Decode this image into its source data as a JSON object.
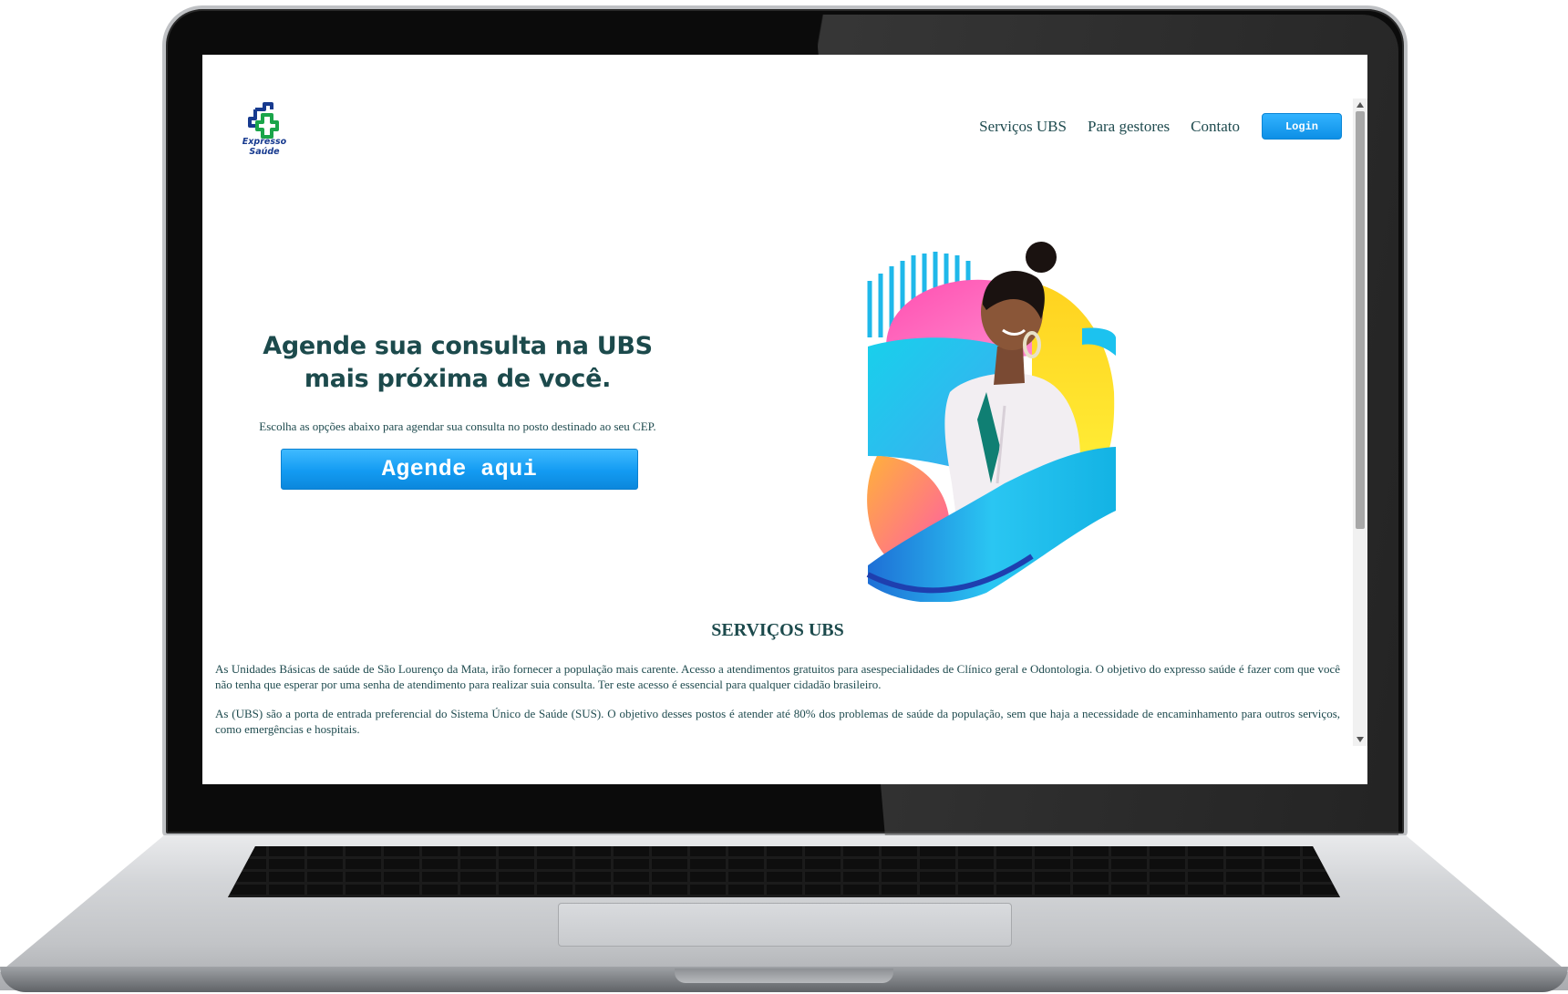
{
  "header": {
    "logo_text": "Expresso Saúde",
    "nav": [
      {
        "label": "Serviços UBS"
      },
      {
        "label": "Para gestores"
      },
      {
        "label": "Contato"
      }
    ],
    "login_label": "Login"
  },
  "hero": {
    "title": "Agende sua consulta na UBS mais próxima de você.",
    "subtitle": "Escolha as opções abaixo para agendar sua consulta no posto destinado ao seu CEP.",
    "cta_label": "Agende aqui"
  },
  "services": {
    "title": "SERVIÇOS UBS",
    "paragraphs": [
      "As Unidades Básicas de saúde de São Lourenço da Mata, irão fornecer a população mais carente. Acesso a atendimentos gratuitos para asespecialidades de Clínico geral e Odontologia. O objetivo do expresso saúde é fazer com que você não tenha que esperar por uma senha de atendimento para realizar suia consulta. Ter este acesso é essencial para qualquer cidadão brasileiro.",
      "As (UBS) são a porta de entrada preferencial do Sistema Único de Saúde (SUS). O objetivo desses postos é atender até 80% dos problemas de saúde da população, sem que haja a necessidade de encaminhamento para outros serviços, como emergências e hospitais."
    ]
  },
  "colors": {
    "accent": "#139bf2",
    "heading": "#1c4a4c",
    "text": "#1f4b4f",
    "logo_blue": "#173a8f",
    "logo_green": "#1aa54a"
  },
  "icons": {
    "logo": "medical-cross-icon",
    "scroll_up": "chevron-up-icon",
    "scroll_down": "chevron-down-icon"
  }
}
